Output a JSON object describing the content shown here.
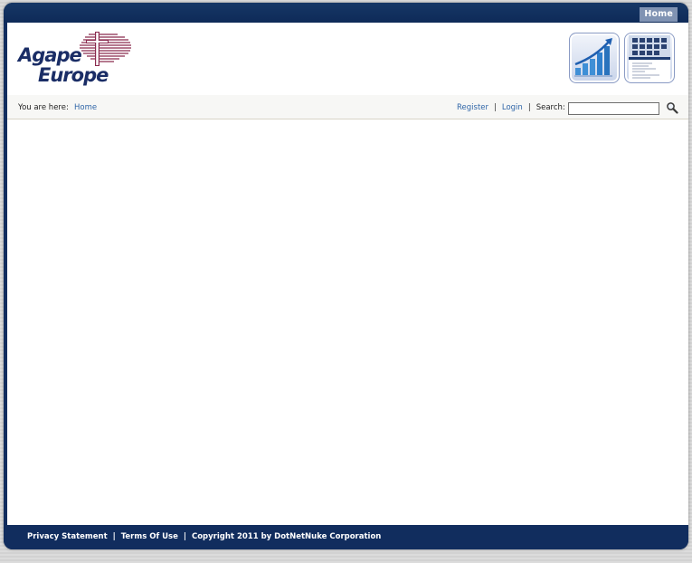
{
  "nav": {
    "home_label": "Home"
  },
  "logo": {
    "line1": "Agape",
    "line2": "Europe"
  },
  "breadcrumb": {
    "label": "You are here:",
    "current": "Home"
  },
  "user_links": {
    "register": "Register",
    "separator": "|",
    "login": "Login",
    "search_label": "Search:"
  },
  "search": {
    "value": "",
    "icon": "magnifier-icon"
  },
  "footer": {
    "privacy": "Privacy Statement",
    "separator": "|",
    "terms": "Terms Of Use",
    "copyright": "Copyright 2011 by DotNetNuke Corporation"
  },
  "colors": {
    "frame_navy": "#112d5e",
    "link_blue": "#3066a8",
    "logo_navy": "#1a2d66",
    "logo_maroon": "#8a2a4e",
    "home_button": "#8093b3"
  }
}
